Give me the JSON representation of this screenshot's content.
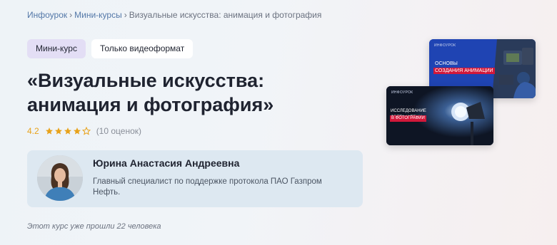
{
  "breadcrumb": {
    "items": [
      "Инфоурок",
      "Мини-курсы",
      "Визуальные искусства: анимация и фотография"
    ],
    "separator": "›"
  },
  "tags": {
    "mini_course": "Мини-курс",
    "video_only": "Только видеоформат"
  },
  "course": {
    "title": "«Визуальные искусства: анимация и фотография»"
  },
  "rating": {
    "score": "4.2",
    "stars_filled": 4,
    "stars_total": 5,
    "count_label": "(10 оценок)"
  },
  "author": {
    "name": "Юрина Анастасия Андреевна",
    "description": "Главный специалист по поддержке протокола ПАО Газпром Нефть."
  },
  "footer": {
    "completed_text": "Этот курс уже прошли 22 человека"
  },
  "cards": {
    "back": {
      "logo": "ИНФОУРОК",
      "line1": "ОСНОВЫ",
      "line2": "СОЗДАНИЯ АНИМАЦИИ"
    },
    "front": {
      "logo": "ИНФОУРОК",
      "line1": "ИССЛЕДОВАНИЕ СВЕТА И ТЕНИ",
      "line2": "В ФОТОГРАФИИ"
    }
  },
  "colors": {
    "accent_rating": "#e8a21a",
    "link": "#5478a8",
    "tag_mini_bg": "#e3def5",
    "author_card_bg": "#dde8f1",
    "card_back_bg": "#1f44b3",
    "card_front_label_bg": "#d1183a"
  }
}
